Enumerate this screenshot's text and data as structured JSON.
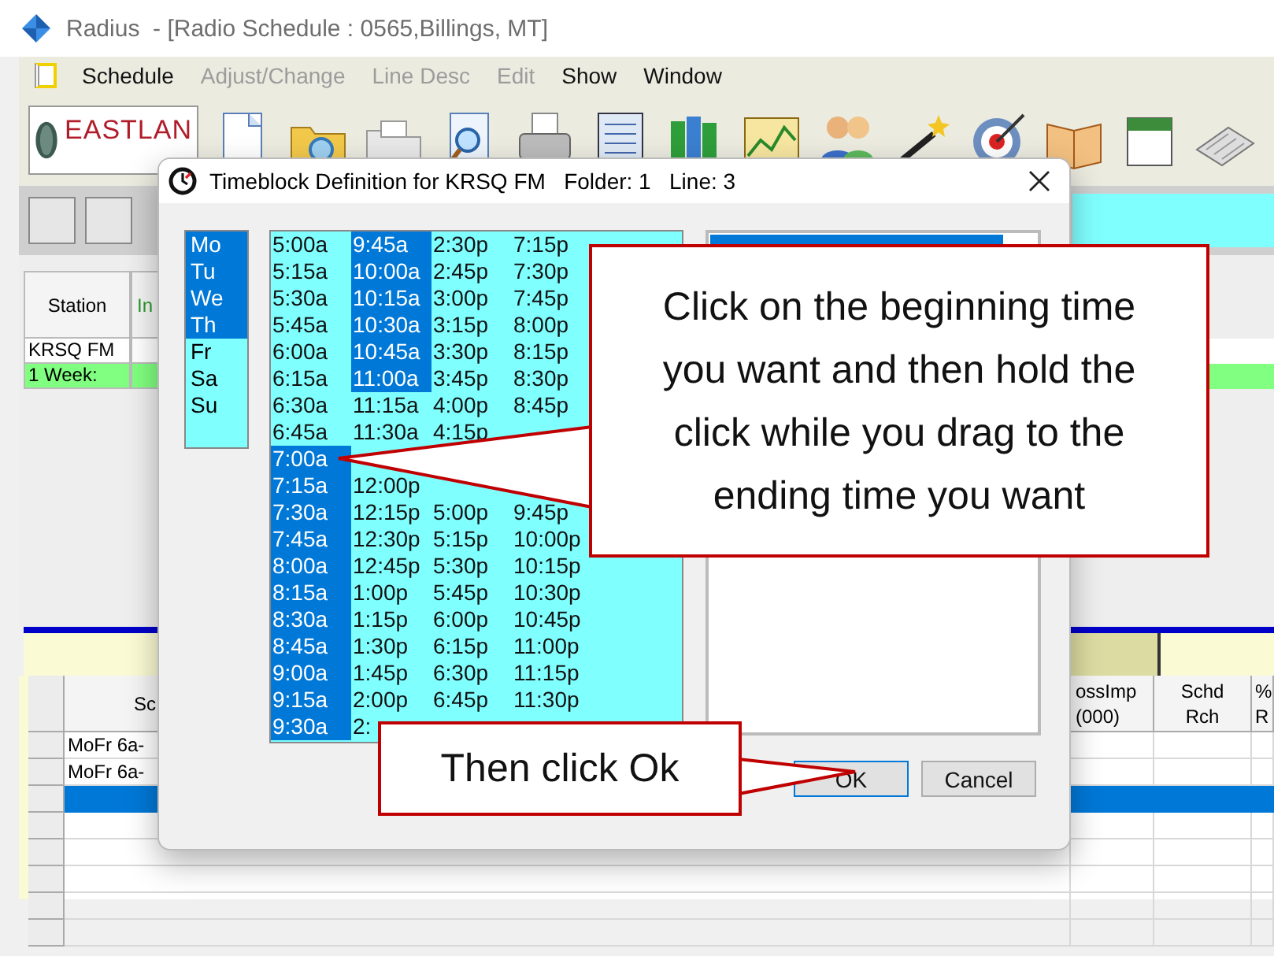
{
  "window": {
    "title": "Radius  - [Radio Schedule : 0565,Billings, MT]"
  },
  "menu": [
    {
      "label": "Schedule",
      "disabled": false
    },
    {
      "label": "Adjust/Change",
      "disabled": true
    },
    {
      "label": "Line Desc",
      "disabled": true
    },
    {
      "label": "Edit",
      "disabled": true
    },
    {
      "label": "Show",
      "disabled": false
    },
    {
      "label": "Window",
      "disabled": false
    }
  ],
  "logo": {
    "text": "EASTLAN"
  },
  "station_grid": {
    "columns": [
      "Station",
      "In"
    ],
    "rows": [
      {
        "kind": "station",
        "cells": [
          "KRSQ FM"
        ]
      },
      {
        "kind": "total",
        "cells": [
          "1 Week:"
        ]
      }
    ]
  },
  "schedule_grid": {
    "columns": [
      "Sc",
      "ossImp\n(000)",
      "Schd\nRch",
      "%\nR"
    ],
    "rows": [
      {
        "selected": false,
        "cells": [
          "MoFr 6a-"
        ]
      },
      {
        "selected": false,
        "cells": [
          "MoFr 6a-"
        ]
      },
      {
        "selected": true
      }
    ]
  },
  "dialog": {
    "title": "Timeblock Definition for KRSQ FM   Folder: 1   Line: 3",
    "days": [
      {
        "label": "Mo",
        "selected": true
      },
      {
        "label": "Tu",
        "selected": true
      },
      {
        "label": "We",
        "selected": true
      },
      {
        "label": "Th",
        "selected": true
      },
      {
        "label": "Fr",
        "selected": false
      },
      {
        "label": "Sa",
        "selected": false
      },
      {
        "label": "Su",
        "selected": false
      }
    ],
    "times": [
      [
        {
          "text": "5:00a",
          "selected": false
        },
        {
          "text": "5:15a",
          "selected": false
        },
        {
          "text": "5:30a",
          "selected": false
        },
        {
          "text": "5:45a",
          "selected": false
        },
        {
          "text": "6:00a",
          "selected": false
        },
        {
          "text": "6:15a",
          "selected": false
        },
        {
          "text": "6:30a",
          "selected": false
        },
        {
          "text": "6:45a",
          "selected": false
        },
        {
          "text": "7:00a",
          "selected": true
        },
        {
          "text": "7:15a",
          "selected": true
        },
        {
          "text": "7:30a",
          "selected": true
        },
        {
          "text": "7:45a",
          "selected": true
        },
        {
          "text": "8:00a",
          "selected": true
        },
        {
          "text": "8:15a",
          "selected": true
        },
        {
          "text": "8:30a",
          "selected": true
        },
        {
          "text": "8:45a",
          "selected": true
        },
        {
          "text": "9:00a",
          "selected": true
        },
        {
          "text": "9:15a",
          "selected": true
        },
        {
          "text": "9:30a",
          "selected": true
        }
      ],
      [
        {
          "text": "9:45a",
          "selected": true
        },
        {
          "text": "10:00a",
          "selected": true
        },
        {
          "text": "10:15a",
          "selected": true
        },
        {
          "text": "10:30a",
          "selected": true
        },
        {
          "text": "10:45a",
          "selected": true
        },
        {
          "text": "11:00a",
          "selected": true
        },
        {
          "text": "11:15a",
          "selected": false
        },
        {
          "text": "11:30a",
          "selected": false
        },
        {
          "kind": "gap"
        },
        {
          "text": "12:00p",
          "selected": false
        },
        {
          "text": "12:15p",
          "selected": false
        },
        {
          "text": "12:30p",
          "selected": false
        },
        {
          "text": "12:45p",
          "selected": false
        },
        {
          "text": "1:00p",
          "selected": false
        },
        {
          "text": "1:15p",
          "selected": false
        },
        {
          "text": "1:30p",
          "selected": false
        },
        {
          "text": "1:45p",
          "selected": false
        },
        {
          "text": "2:00p",
          "selected": false
        },
        {
          "text": "2:",
          "selected": false
        }
      ],
      [
        {
          "text": "2:30p",
          "selected": false
        },
        {
          "text": "2:45p",
          "selected": false
        },
        {
          "text": "3:00p",
          "selected": false
        },
        {
          "text": "3:15p",
          "selected": false
        },
        {
          "text": "3:30p",
          "selected": false
        },
        {
          "text": "3:45p",
          "selected": false
        },
        {
          "text": "4:00p",
          "selected": false
        },
        {
          "text": "4:15p",
          "selected": false
        },
        {
          "kind": "gap"
        },
        {
          "kind": "gap"
        },
        {
          "text": "5:00p",
          "selected": false
        },
        {
          "text": "5:15p",
          "selected": false
        },
        {
          "text": "5:30p",
          "selected": false
        },
        {
          "text": "5:45p",
          "selected": false
        },
        {
          "text": "6:00p",
          "selected": false
        },
        {
          "text": "6:15p",
          "selected": false
        },
        {
          "text": "6:30p",
          "selected": false
        },
        {
          "text": "6:45p",
          "selected": false
        }
      ],
      [
        {
          "text": "7:15p",
          "selected": false
        },
        {
          "text": "7:30p",
          "selected": false
        },
        {
          "text": "7:45p",
          "selected": false
        },
        {
          "text": "8:00p",
          "selected": false
        },
        {
          "text": "8:15p",
          "selected": false
        },
        {
          "text": "8:30p",
          "selected": false
        },
        {
          "text": "8:45p",
          "selected": false
        },
        {
          "kind": "gap"
        },
        {
          "kind": "gap"
        },
        {
          "kind": "gap"
        },
        {
          "text": "9:45p",
          "selected": false
        },
        {
          "text": "10:00p",
          "selected": false
        },
        {
          "text": "10:15p",
          "selected": false
        },
        {
          "text": "10:30p",
          "selected": false
        },
        {
          "text": "10:45p",
          "selected": false
        },
        {
          "text": "11:00p",
          "selected": false
        },
        {
          "text": "11:15p",
          "selected": false
        },
        {
          "text": "11:30p",
          "selected": false
        }
      ]
    ],
    "blocks": [
      {
        "selected": true
      }
    ],
    "buttons": [
      "OK",
      "Cancel"
    ]
  },
  "callouts": [
    {
      "text": "Click on the beginning time you want and then hold the click while you drag to the ending time you want"
    },
    {
      "text": "Then click Ok"
    }
  ]
}
